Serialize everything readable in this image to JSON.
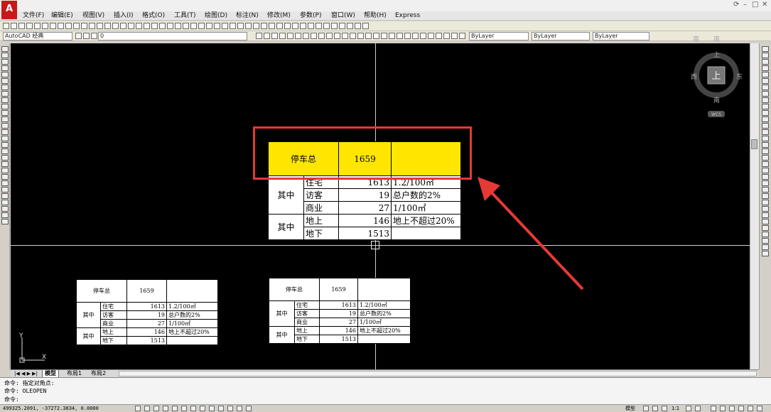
{
  "window": {
    "logo": "A",
    "controls": [
      "⟳",
      "–",
      "□",
      "✕"
    ]
  },
  "menu": [
    "文件(F)",
    "编辑(E)",
    "视图(V)",
    "插入(I)",
    "格式(O)",
    "工具(T)",
    "绘图(D)",
    "标注(N)",
    "修改(M)",
    "参数(P)",
    "窗口(W)",
    "帮助(H)",
    "Express"
  ],
  "toolbar2": {
    "workspace": "AutoCAD 经典",
    "layer": "0",
    "layer_color": "ByLayer",
    "linetype": "ByLayer",
    "lineweight": "ByLayer"
  },
  "viewcube": {
    "north": "南",
    "south": "南",
    "west": "西",
    "east": "东",
    "top": "上",
    "top_right": "南",
    "center": "上",
    "wcs": "WCS"
  },
  "main_table": {
    "title": "停车总",
    "total": "1659",
    "groups": [
      {
        "label": "其中",
        "rows": [
          {
            "name": "住宅",
            "value": "1613",
            "note": "1.2/100㎡"
          },
          {
            "name": "访客",
            "value": "19",
            "note": "总户数的2%"
          },
          {
            "name": "商业",
            "value": "27",
            "note": "1/100㎡"
          }
        ]
      },
      {
        "label": "其中",
        "rows": [
          {
            "name": "地上",
            "value": "146",
            "note": "地上不超过20%"
          },
          {
            "name": "地下",
            "value": "1513",
            "note": ""
          }
        ]
      }
    ]
  },
  "small_table_1": {
    "title": "停车总",
    "total": "1659",
    "g1": "其中",
    "g2": "其中",
    "r1": [
      "住宅",
      "1613",
      "1.2/100㎡"
    ],
    "r2": [
      "访客",
      "19",
      "总户数的2%"
    ],
    "r3": [
      "商业",
      "27",
      "1/100㎡"
    ],
    "r4": [
      "地上",
      "146",
      "地上不超过20%"
    ],
    "r5": [
      "地下",
      "1513",
      ""
    ]
  },
  "small_table_2": {
    "title": "停车总",
    "total": "1659",
    "g1": "其中",
    "g2": "其中",
    "r1": [
      "住宅",
      "1613",
      "1.2/100㎡"
    ],
    "r2": [
      "访客",
      "19",
      "总户数的2%"
    ],
    "r3": [
      "商业",
      "27",
      "1/100㎡"
    ],
    "r4": [
      "地上",
      "146",
      "地上不超过20%"
    ],
    "r5": [
      "地下",
      "1513",
      ""
    ]
  },
  "ucs": {
    "y": "Y",
    "x": "X"
  },
  "tabs": [
    "模型",
    "布局1",
    "布局2"
  ],
  "command": [
    "命令: 指定对角点:",
    "命令: OLEOPEN",
    "命令:"
  ],
  "status": {
    "coords": "499325.2091, -37272.3834, 0.0000",
    "right_label": "模型",
    "scale": "1:1"
  }
}
